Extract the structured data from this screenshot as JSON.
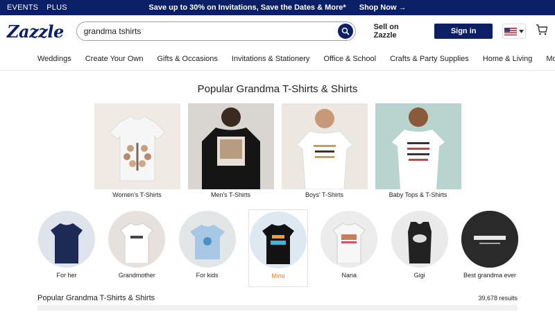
{
  "promo": {
    "left_links": [
      "EVENTS",
      "PLUS"
    ],
    "message": "Save up to 30% on Invitations, Save the Dates & More*",
    "cta": "Shop Now →"
  },
  "header": {
    "logo": "Zazzle",
    "search_value": "grandma tshirts",
    "sell_label": "Sell on Zazzle",
    "signin_label": "Sign in"
  },
  "nav": [
    "Weddings",
    "Create Your Own",
    "Gifts & Occasions",
    "Invitations & Stationery",
    "Office & School",
    "Crafts & Party Supplies",
    "Home & Living",
    "More"
  ],
  "section_title": "Popular Grandma T-Shirts & Shirts",
  "categories": [
    {
      "label": "Women's T-Shirts",
      "bg": "#efeae4"
    },
    {
      "label": "Men's T-Shirts",
      "bg": "#d9d6d1"
    },
    {
      "label": "Boys' T-Shirts",
      "bg": "#ece8e1"
    },
    {
      "label": "Baby Tops & T-Shirts",
      "bg": "#b9d3cf"
    }
  ],
  "styles": [
    {
      "label": "For her",
      "bg": "#dfe3ec",
      "shirt": "#1d2a55"
    },
    {
      "label": "Grandmother",
      "bg": "#e6e1dc",
      "shirt": "#ffffff"
    },
    {
      "label": "For kids",
      "bg": "#e3e6e6",
      "shirt": "#a8c7e5"
    },
    {
      "label": "Mimi",
      "bg": "#dde8f1",
      "shirt": "#121212"
    },
    {
      "label": "Nana",
      "bg": "#ececec",
      "shirt": "#f7f7f7"
    },
    {
      "label": "Gigi",
      "bg": "#eaeaea",
      "shirt": "#222222"
    },
    {
      "label": "Best grandma ever",
      "bg": "#333333",
      "shirt": "#1e1e1e"
    }
  ],
  "results_title": "Popular Grandma T-Shirts & Shirts",
  "results_count": "39,678 results",
  "colors": {
    "brand": "#0b1f66",
    "accent": "#e07b20"
  }
}
